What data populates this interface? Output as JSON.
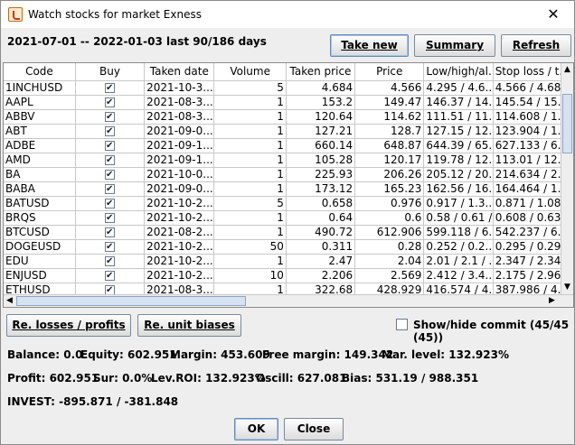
{
  "window": {
    "title": "Watch stocks for market Exness",
    "close_glyph": "✕"
  },
  "period": "2021-07-01 -- 2022-01-03 last 90/186 days",
  "buttons": {
    "take_new": "Take new",
    "summary": "Summary",
    "refresh": "Refresh",
    "re_losses": "Re. losses / profits",
    "re_unit": "Re. unit biases",
    "ok": "OK",
    "close": "Close"
  },
  "table": {
    "headers": [
      "Code",
      "Buy",
      "Taken date",
      "Volume",
      "Taken price",
      "Price",
      "Low/high/al...",
      "Stop loss / t..."
    ],
    "rows": [
      [
        "1INCHUSD",
        "2021-10-3...",
        "5",
        "4.684",
        "4.566",
        "4.295 / 4.6...",
        "4.566 / 4.684"
      ],
      [
        "AAPL",
        "2021-08-3...",
        "1",
        "153.2",
        "149.47",
        "146.37 / 14...",
        "145.54 / 15..."
      ],
      [
        "ABBV",
        "2021-08-3...",
        "1",
        "120.64",
        "114.62",
        "111.51 / 11...",
        "114.608 / 1..."
      ],
      [
        "ABT",
        "2021-09-0...",
        "1",
        "127.21",
        "128.7",
        "127.15 / 12...",
        "123.904 / 1..."
      ],
      [
        "ADBE",
        "2021-09-1...",
        "1",
        "660.14",
        "648.87",
        "644.39 / 65...",
        "627.133 / 6..."
      ],
      [
        "AMD",
        "2021-09-1...",
        "1",
        "105.28",
        "120.17",
        "119.78 / 12...",
        "113.01 / 12..."
      ],
      [
        "BA",
        "2021-10-0...",
        "1",
        "225.93",
        "206.26",
        "205.12 / 20...",
        "214.634 / 2..."
      ],
      [
        "BABA",
        "2021-09-0...",
        "1",
        "173.12",
        "165.23",
        "162.56 / 16...",
        "164.464 / 1..."
      ],
      [
        "BATUSD",
        "2021-10-2...",
        "5",
        "0.658",
        "0.976",
        "0.917 / 1.3...",
        "0.871 / 1.082"
      ],
      [
        "BRQS",
        "2021-10-2...",
        "1",
        "0.64",
        "0.6",
        "0.58 / 0.61 /...",
        "0.608 / 0.636"
      ],
      [
        "BTCUSD",
        "2021-08-2...",
        "1",
        "490.72",
        "612.906",
        "599.118 / 6...",
        "542.237 / 6..."
      ],
      [
        "DOGEUSD",
        "2021-10-2...",
        "50",
        "0.311",
        "0.28",
        "0.252 / 0.2...",
        "0.295 / 0.299"
      ],
      [
        "EDU",
        "2021-10-2...",
        "1",
        "2.47",
        "2.04",
        "2.01 / 2.1 / ...",
        "2.347 / 2.347"
      ],
      [
        "ENJUSD",
        "2021-10-2...",
        "10",
        "2.206",
        "2.569",
        "2.412 / 3.4...",
        "2.175 / 2.962"
      ],
      [
        "ETHUSD",
        "2021-08-3...",
        "1",
        "322.68",
        "428.929",
        "416.574 / 4...",
        "387.986 / 4..."
      ]
    ]
  },
  "show_hide": "Show/hide commit (45/45 (45))",
  "stats": {
    "balance": "Balance: 0.0",
    "equity": "Equity: 602.951",
    "margin": "Margin: 453.609",
    "free_margin": "Free margin: 149.342",
    "mar_level": "Mar. level: 132.923%",
    "profit": "Profit: 602.951",
    "sur": "Sur: 0.0%",
    "lev_roi": "Lev.ROI: 132.923%",
    "oscill": "Oscill: 627.081",
    "bias": "Bias: 531.19 / 988.351",
    "invest": "INVEST: -895.871 / -381.848"
  }
}
